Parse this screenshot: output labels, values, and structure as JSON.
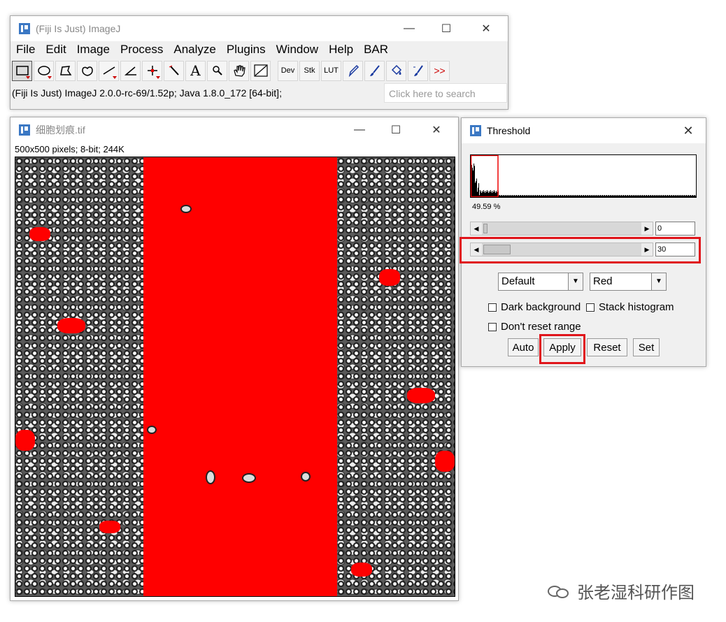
{
  "main_window": {
    "title": "(Fiji Is Just) ImageJ",
    "menu": [
      "File",
      "Edit",
      "Image",
      "Process",
      "Analyze",
      "Plugins",
      "Window",
      "Help",
      "BAR"
    ],
    "tools_text": {
      "dev": "Dev",
      "stk": "Stk",
      "lut": "LUT",
      "more": ">>",
      "text_tool": "A"
    },
    "status": "(Fiji Is Just) ImageJ 2.0.0-rc-69/1.52p; Java 1.8.0_172 [64-bit];",
    "search_placeholder": "Click here to search"
  },
  "image_window": {
    "title": "细胞划痕.tif",
    "info": "500x500 pixels; 8-bit; 244K"
  },
  "threshold": {
    "title": "Threshold",
    "percent": "49.59 %",
    "min_value": "0",
    "max_value": "30",
    "min_fraction": 0.0,
    "max_fraction": 0.118,
    "method": "Default",
    "display": "Red",
    "dark_background": "Dark background",
    "stack_histogram": "Stack histogram",
    "dont_reset": "Don't reset range",
    "buttons": {
      "auto": "Auto",
      "apply": "Apply",
      "reset": "Reset",
      "set": "Set"
    }
  },
  "window_controls": {
    "minimize": "—",
    "maximize": "☐",
    "close": "✕"
  },
  "watermark": "张老湿科研作图",
  "colors": {
    "threshold_overlay": "#ff0000",
    "highlight": "#e0151b",
    "app_icon": "#3b78c4"
  }
}
